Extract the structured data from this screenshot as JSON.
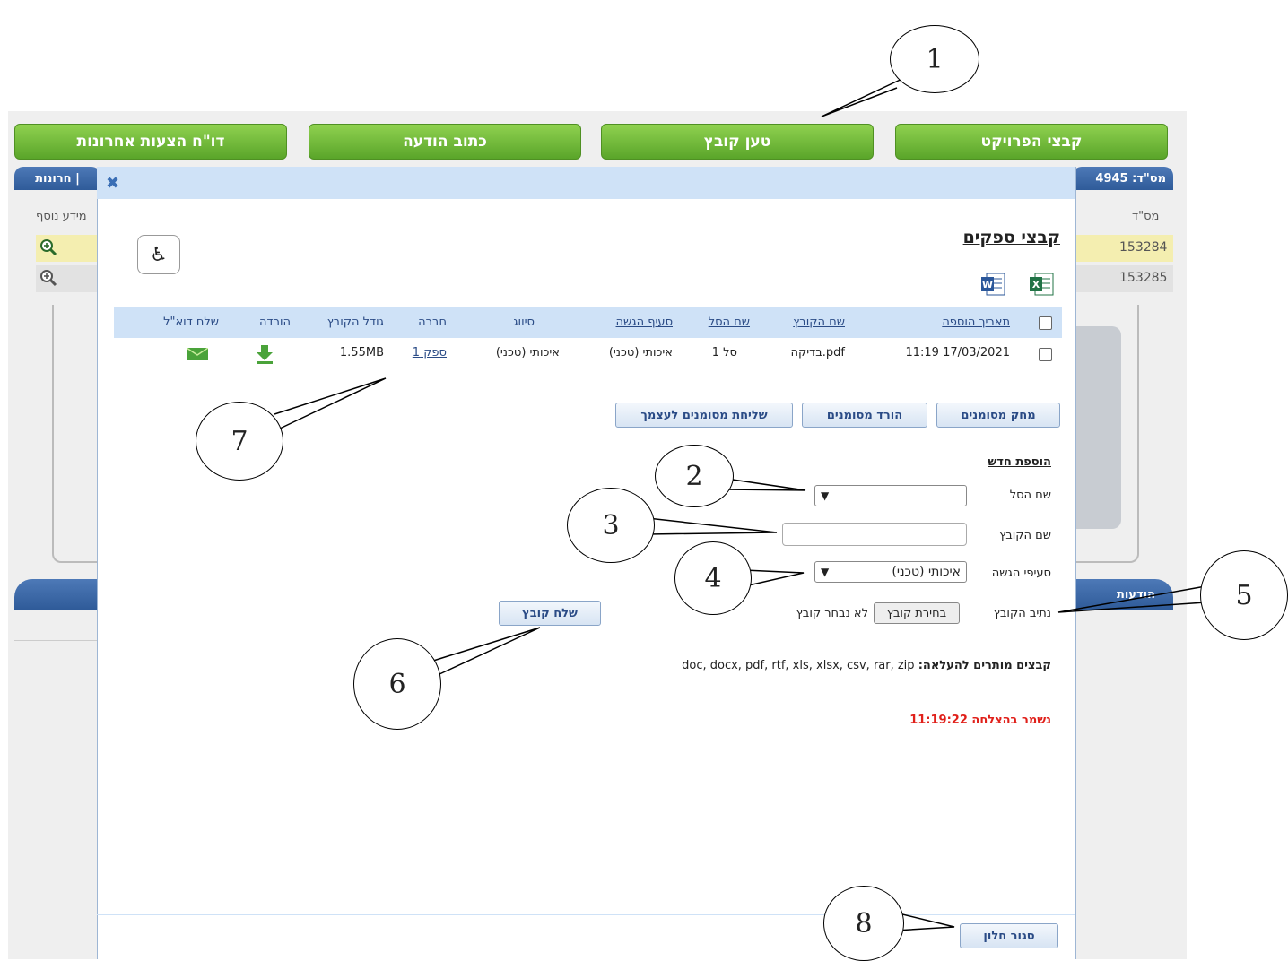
{
  "top_buttons": {
    "project_files": "קבצי הפרויקט",
    "upload_file": "טען קובץ",
    "write_message": "כתוב הודעה",
    "recent_offers_report": "דו\"ח הצעות אחרונות"
  },
  "background": {
    "tender_label": "מס\"ד: 4945",
    "tab_fragment": "חרונות |",
    "col_id": "מס\"ד",
    "col_more_info": "מידע נוסף",
    "rows": [
      "153284",
      "153285"
    ],
    "messages_tab": "הודעות"
  },
  "modal": {
    "close_icon": "✖",
    "title": "קבצי ספקים",
    "table": {
      "headers": {
        "date_added": "תאריך הוספה",
        "file_name": "שם הקובץ",
        "basket_name": "שם הסל",
        "submission_section": "סעיף הגשה",
        "classification": "סיווג",
        "company": "חברה",
        "file_size": "גודל הקובץ",
        "download": "הורדה",
        "send_email": "שלח דוא\"ל"
      },
      "rows": [
        {
          "date": "11:19 17/03/2021",
          "file_name": "בדיקה.pdf",
          "basket": "סל 1",
          "section": "איכותי (טכני)",
          "classification": "איכותי (טכני)",
          "company": "ספק 1",
          "size": "1.55MB"
        }
      ]
    },
    "actions": {
      "delete_selected": "מחק מסומנים",
      "download_selected": "הורד מסומנים",
      "send_selected_to_self": "שליחת מסומנים לעצמך"
    },
    "add_new": {
      "heading": "הוספת חדש",
      "basket_label": "שם הסל",
      "basket_value": "",
      "file_name_label": "שם הקובץ",
      "file_name_value": "",
      "section_label": "סעיפי הגשה",
      "section_value": "איכותי (טכני)",
      "path_label": "נתיב הקובץ",
      "choose_file": "בחירת קובץ",
      "no_file_chosen": "לא נבחר קובץ",
      "send_file": "שלח קובץ",
      "allowed_label": "קבצים מותרים להעלאה",
      "allowed_types": "doc, docx, pdf, rtf, xls, xlsx, csv, rar, zip",
      "saved_msg": "נשמר בהצלחה 11:19:22"
    },
    "close_window": "סגור חלון"
  },
  "callouts": [
    "1",
    "2",
    "3",
    "4",
    "5",
    "6",
    "7",
    "8"
  ],
  "colors": {
    "green": "#5aa52a",
    "blue_header": "#cfe2f7",
    "link": "#2a4b86",
    "success_red": "#e0201a"
  },
  "icons": {
    "close": "close-icon",
    "accessibility": "wheelchair-icon",
    "excel": "excel-icon",
    "word": "word-icon",
    "download": "download-arrow-icon",
    "email": "envelope-icon",
    "zoom": "zoom-in-icon"
  }
}
